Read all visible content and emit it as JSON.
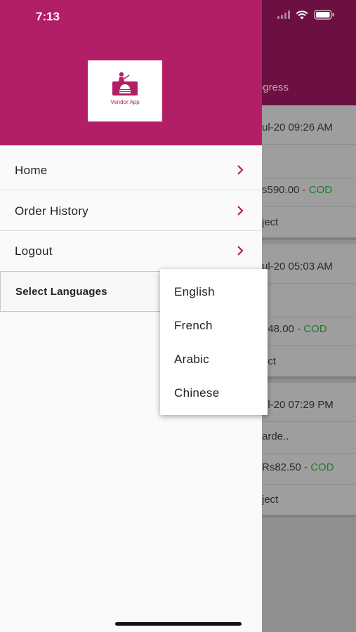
{
  "status": {
    "time": "7:13"
  },
  "background": {
    "tab_partial": "ogress",
    "orders": [
      {
        "date": "ul-20 09:26 AM",
        "name": "",
        "amount": "s590.00",
        "payment": "COD",
        "action": "ject"
      },
      {
        "date": "ul-20 05:03 AM",
        "name": "",
        "amount": "248.00",
        "payment": "COD",
        "action": "ect"
      },
      {
        "date": "ul-20 07:29 PM",
        "name": "arde..",
        "amount": "Rs82.50",
        "payment": "COD",
        "action": "ject"
      }
    ],
    "dash": "-"
  },
  "drawer": {
    "logo_text": "Vendor App",
    "menu": [
      {
        "label": "Home"
      },
      {
        "label": "Order History"
      },
      {
        "label": "Logout"
      }
    ],
    "select_languages": "Select Languages"
  },
  "language_options": [
    "English",
    "French",
    "Arabic",
    "Chinese"
  ],
  "colors": {
    "brand": "#b31f66",
    "cod_green": "#1a7f2a"
  }
}
